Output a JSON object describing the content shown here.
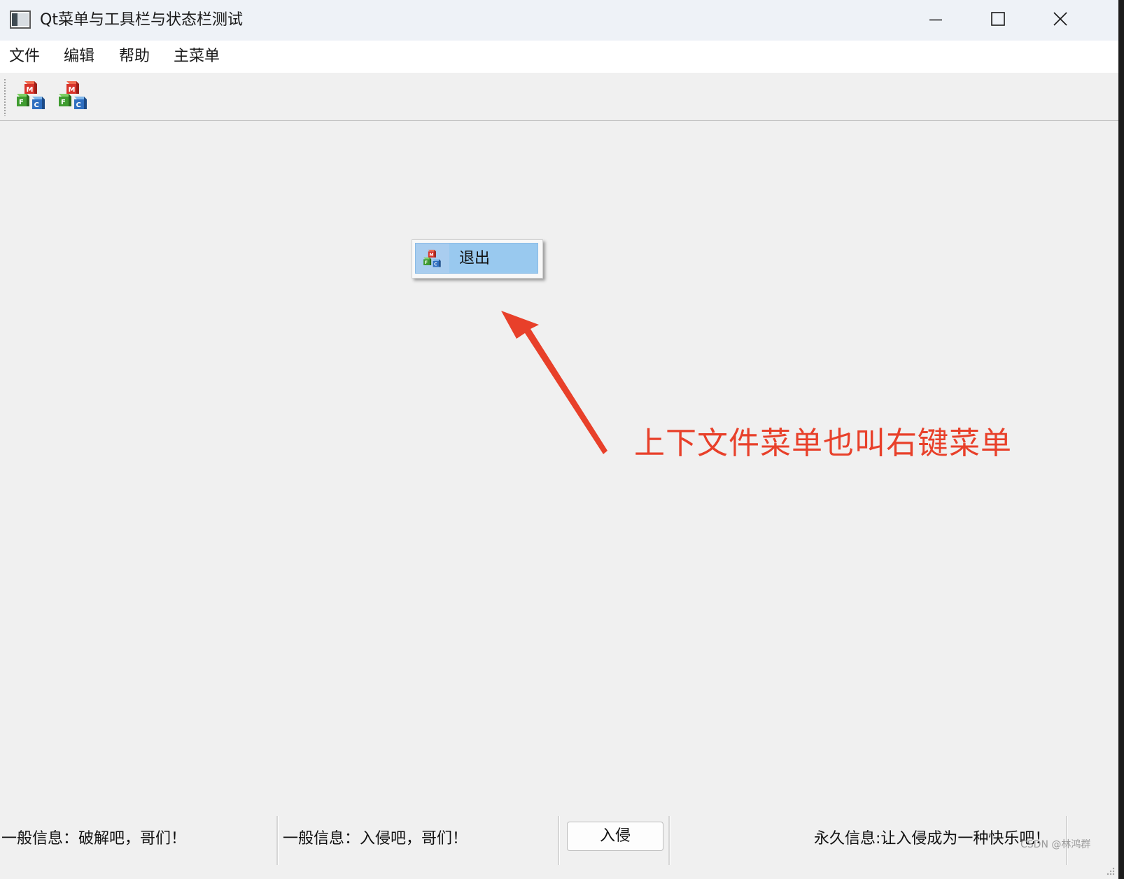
{
  "window": {
    "title": "Qt菜单与工具栏与状态栏测试"
  },
  "menubar": {
    "items": [
      "文件",
      "编辑",
      "帮助",
      "主菜单"
    ]
  },
  "toolbar": {
    "buttons": [
      {
        "icon": "mfc-cube-icon"
      },
      {
        "icon": "mfc-cube-icon"
      }
    ]
  },
  "context_menu": {
    "items": [
      {
        "label": "退出",
        "icon": "mfc-cube-icon",
        "highlighted": true
      }
    ]
  },
  "annotation": {
    "text": "上下文件菜单也叫右键菜单",
    "color": "#e8402a"
  },
  "statusbar": {
    "message_1": "一般信息：破解吧，哥们！",
    "message_2": "一般信息：入侵吧，哥们！",
    "button_label": "入侵",
    "permanent_message": "永久信息:让入侵成为一种快乐吧！"
  },
  "watermark": "CSDN @林鸿群"
}
